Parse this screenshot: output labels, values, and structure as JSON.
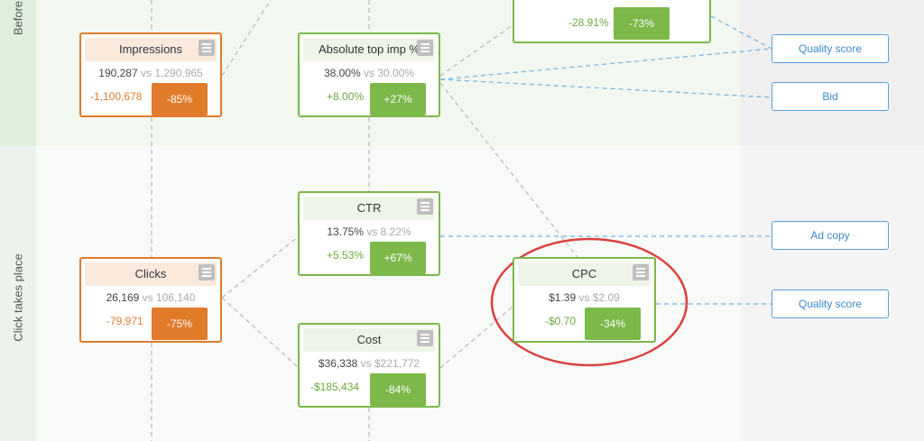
{
  "bands": {
    "top_label": "Before",
    "bottom_label": "Click takes place"
  },
  "top_partial_card": {
    "delta": "-28.91%",
    "pct": "-73%"
  },
  "cards": {
    "impressions": {
      "title": "Impressions",
      "value": "190,287",
      "vs": "vs",
      "compare": "1,290,965",
      "delta": "-1,100,678",
      "pct": "-85%"
    },
    "abs_top": {
      "title": "Absolute top imp %",
      "value": "38.00%",
      "vs": "vs",
      "compare": "30.00%",
      "delta": "+8.00%",
      "pct": "+27%"
    },
    "ctr": {
      "title": "CTR",
      "value": "13.75%",
      "vs": "vs",
      "compare": "8.22%",
      "delta": "+5.53%",
      "pct": "+67%"
    },
    "clicks": {
      "title": "Clicks",
      "value": "26,169",
      "vs": "vs",
      "compare": "106,140",
      "delta": "-79,971",
      "pct": "-75%"
    },
    "cpc": {
      "title": "CPC",
      "value": "$1.39",
      "vs": "vs",
      "compare": "$2.09",
      "delta": "-$0.70",
      "pct": "-34%"
    },
    "cost": {
      "title": "Cost",
      "value": "$36,338",
      "vs": "vs",
      "compare": "$221,772",
      "delta": "-$185,434",
      "pct": "-84%"
    }
  },
  "factors": {
    "quality_score_top": "Quality score",
    "bid": "Bid",
    "ad_copy": "Ad copy",
    "quality_score_bottom": "Quality score"
  },
  "colors": {
    "green": "#7cb84a",
    "orange": "#e07b2a",
    "blue": "#5aa0d8",
    "highlight_red": "#d9413f"
  }
}
